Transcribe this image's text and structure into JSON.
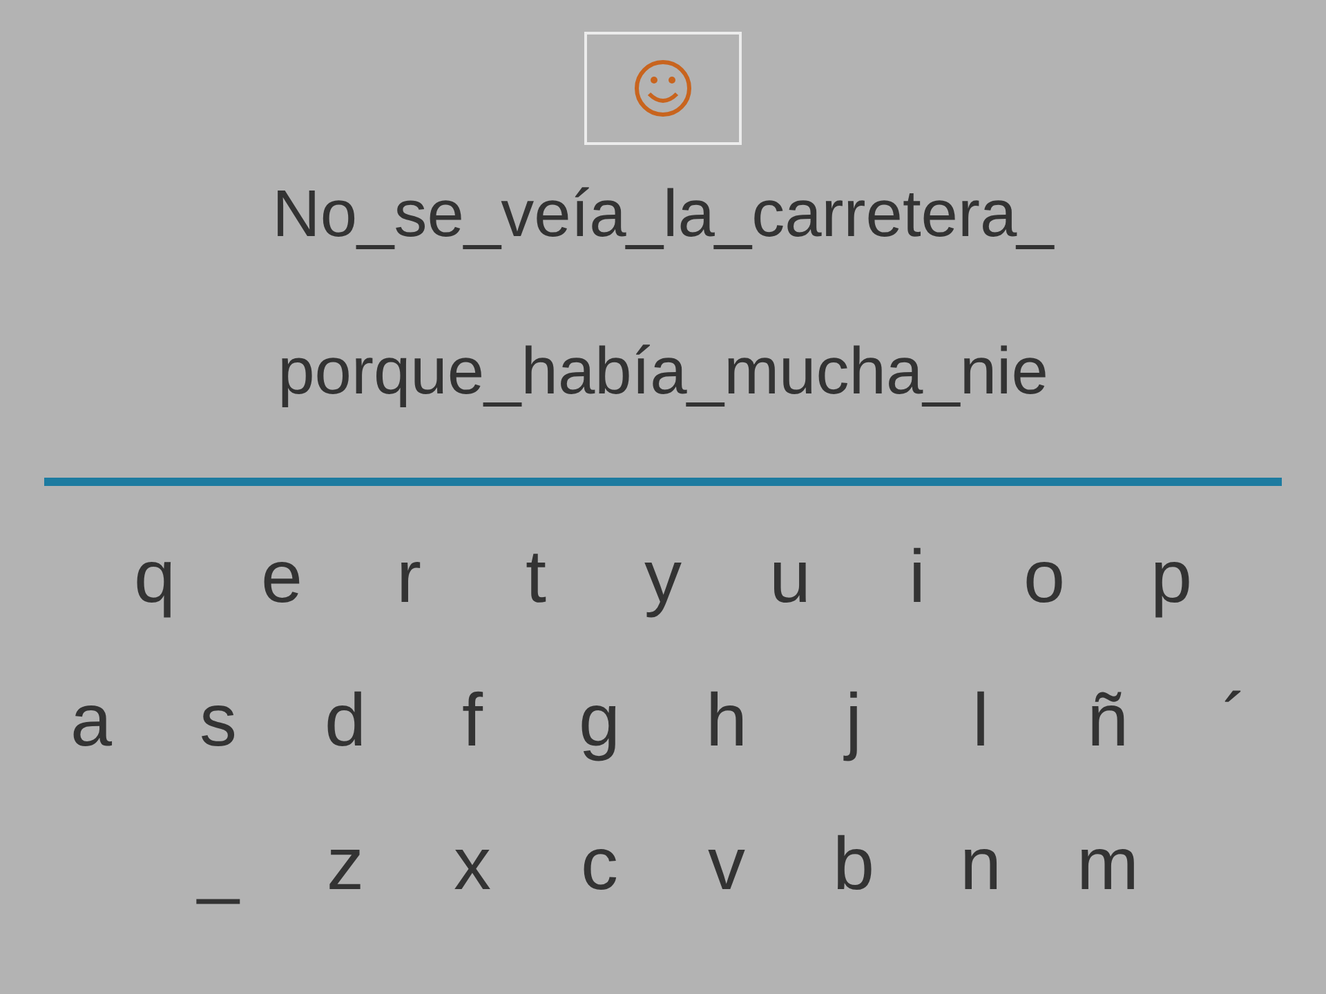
{
  "sentence_lines": [
    "No_se_veía_la_carretera_",
    "porque_había_mucha_nie"
  ],
  "keyboard_rows": [
    [
      "q",
      "e",
      "r",
      "t",
      "y",
      "u",
      "i",
      "o",
      "p"
    ],
    [
      "a",
      "s",
      "d",
      "f",
      "g",
      "h",
      "j",
      "l",
      "ñ",
      "´"
    ],
    [
      "_",
      "z",
      "x",
      "c",
      "v",
      "b",
      "n",
      "m"
    ]
  ]
}
